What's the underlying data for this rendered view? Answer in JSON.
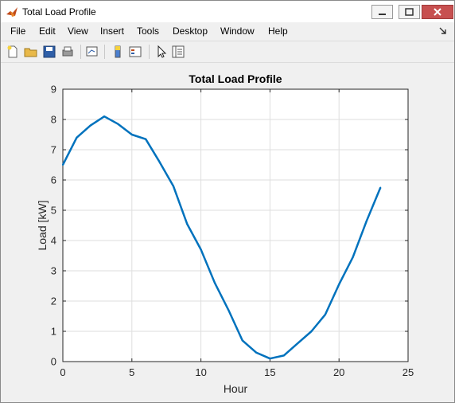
{
  "window": {
    "title": "Total Load Profile"
  },
  "menu": [
    "File",
    "Edit",
    "View",
    "Insert",
    "Tools",
    "Desktop",
    "Window",
    "Help"
  ],
  "toolbar_icons": [
    "new-figure-icon",
    "open-file-icon",
    "save-icon",
    "print-icon",
    "link-plot-icon",
    "colorbar-icon",
    "legend-icon",
    "pointer-icon",
    "property-inspector-icon"
  ],
  "colors": {
    "line": "#0072BD",
    "axes_bg": "#ffffff",
    "figure_bg": "#f0f0f0",
    "grid": "#dedede"
  },
  "chart_data": {
    "type": "line",
    "title": "Total Load Profile",
    "xlabel": "Hour",
    "ylabel": "Load [kW]",
    "xlim": [
      0,
      25
    ],
    "ylim": [
      0,
      9
    ],
    "xticks": [
      "0",
      "5",
      "10",
      "15",
      "20",
      "25"
    ],
    "yticks": [
      "0",
      "1",
      "2",
      "3",
      "4",
      "5",
      "6",
      "7",
      "8",
      "9"
    ],
    "grid": true,
    "series": [
      {
        "x": [
          0,
          1,
          2,
          3,
          4,
          5,
          6,
          7,
          8,
          9,
          10,
          11,
          12,
          13,
          14,
          15,
          16,
          17,
          18,
          19,
          20,
          21,
          22,
          23
        ],
        "y": [
          6.5,
          7.4,
          7.8,
          8.1,
          7.85,
          7.5,
          7.35,
          6.6,
          5.8,
          4.55,
          3.7,
          2.6,
          1.7,
          0.7,
          0.3,
          0.1,
          0.2,
          0.6,
          1.0,
          1.55,
          2.55,
          3.45,
          4.65,
          5.75
        ]
      }
    ]
  }
}
